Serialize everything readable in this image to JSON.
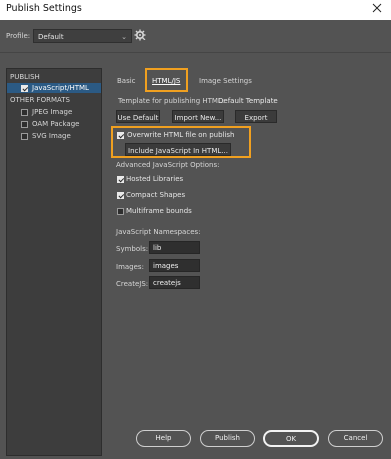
{
  "window": {
    "title": "Publish Settings",
    "close_icon": "close-icon"
  },
  "profile": {
    "label": "Profile:",
    "value": "Default",
    "gear_icon": "gear-icon"
  },
  "sidebar": {
    "publish_header": "PUBLISH",
    "publish_items": [
      {
        "label": "JavaScript/HTML",
        "checked": true,
        "selected": true
      }
    ],
    "other_header": "OTHER FORMATS",
    "other_items": [
      {
        "label": "JPEG Image",
        "checked": false
      },
      {
        "label": "OAM Package",
        "checked": false
      },
      {
        "label": "SVG Image",
        "checked": false
      }
    ]
  },
  "tabs": [
    {
      "label": "Basic",
      "active": false
    },
    {
      "label": "HTML/JS",
      "active": true
    },
    {
      "label": "Image Settings",
      "active": false
    }
  ],
  "template": {
    "label": "Template for publishing HTML:",
    "value": "Default Template",
    "buttons": [
      "Use Default",
      "Import New...",
      "Export"
    ]
  },
  "overwrite": {
    "label": "Overwrite HTML file on publish",
    "checked": true,
    "include_button": "Include JavaScript In HTML..."
  },
  "advanced": {
    "header": "Advanced JavaScript Options:",
    "options": [
      {
        "label": "Hosted Libraries",
        "checked": true
      },
      {
        "label": "Compact Shapes",
        "checked": true
      },
      {
        "label": "Multiframe bounds",
        "checked": false
      }
    ]
  },
  "namespaces": {
    "header": "JavaScript Namespaces:",
    "fields": [
      {
        "label": "Symbols:",
        "value": "lib"
      },
      {
        "label": "Images:",
        "value": "images"
      },
      {
        "label": "CreateJS:",
        "value": "createjs"
      }
    ]
  },
  "footer": {
    "help": "Help",
    "publish": "Publish",
    "ok": "OK",
    "cancel": "Cancel"
  },
  "colors": {
    "highlight": "#f0a020",
    "selection": "#2b5a84",
    "background": "#535353"
  }
}
